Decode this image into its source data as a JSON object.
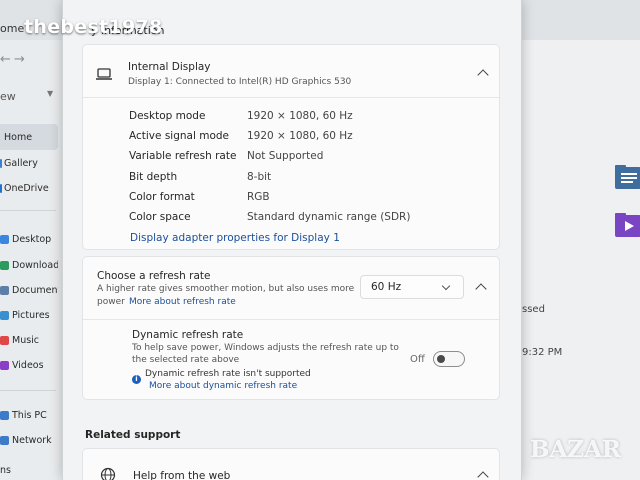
{
  "watermark": "thebest1978",
  "bazar_logo": "BAZAR",
  "explorer": {
    "tab_title": "ome",
    "view_label": "ew",
    "sidebar": [
      {
        "label": "Home",
        "icon": "home-icon",
        "color": "#e2e6e9"
      },
      {
        "label": "Gallery",
        "icon": "gallery-icon",
        "color": "#3b7fd6"
      },
      {
        "label": "OneDrive",
        "icon": "onedrive-icon",
        "color": "#1e74d3"
      },
      {
        "label": "Desktop",
        "icon": "desktop-icon",
        "color": "#3a86e0"
      },
      {
        "label": "Downloads",
        "icon": "downloads-icon",
        "color": "#2d9a5e"
      },
      {
        "label": "Documents",
        "icon": "documents-icon",
        "color": "#5b7fa8"
      },
      {
        "label": "Pictures",
        "icon": "pictures-icon",
        "color": "#3a8fd0"
      },
      {
        "label": "Music",
        "icon": "music-icon",
        "color": "#e04848"
      },
      {
        "label": "Videos",
        "icon": "videos-icon",
        "color": "#8a3fc6"
      },
      {
        "label": "This PC",
        "icon": "this-pc-icon",
        "color": "#3c7bc9"
      },
      {
        "label": "Network",
        "icon": "network-icon",
        "color": "#3c7bc9"
      },
      {
        "label": "ns",
        "icon": "",
        "color": ""
      }
    ],
    "right_text_1": "ssed",
    "right_text_2": "9:32 PM"
  },
  "settings": {
    "header_partial": "y information",
    "internal_display": {
      "title": "Internal Display",
      "subtitle": "Display 1: Connected to Intel(R) HD Graphics 530",
      "rows": [
        {
          "label": "Desktop mode",
          "value": "1920 × 1080, 60 Hz"
        },
        {
          "label": "Active signal mode",
          "value": "1920 × 1080, 60 Hz"
        },
        {
          "label": "Variable refresh rate",
          "value": "Not Supported"
        },
        {
          "label": "Bit depth",
          "value": "8-bit"
        },
        {
          "label": "Color format",
          "value": "RGB"
        },
        {
          "label": "Color space",
          "value": "Standard dynamic range (SDR)"
        }
      ],
      "adapter_link": "Display adapter properties for Display 1"
    },
    "refresh": {
      "title": "Choose a refresh rate",
      "desc_line1": "A higher rate gives smoother motion, but also uses more",
      "desc_line2": "power",
      "more_link": "More about refresh rate",
      "selected": "60 Hz",
      "drr_title": "Dynamic refresh rate",
      "drr_desc_line1": "To help save power, Windows adjusts the refresh rate up to",
      "drr_desc_line2": "the selected rate above",
      "toggle_label": "Off",
      "toggle_on": false,
      "not_supported": "Dynamic refresh rate isn't supported",
      "drr_more_link": "More about dynamic refresh rate"
    },
    "related_support": {
      "heading": "Related support",
      "help_title": "Help from the web"
    }
  }
}
